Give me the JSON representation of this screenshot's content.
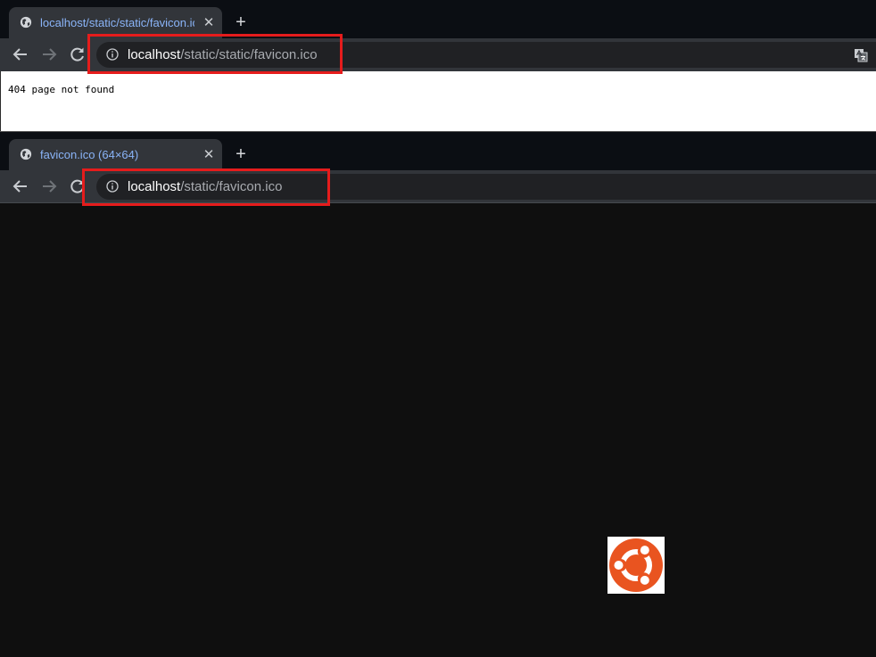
{
  "windows": [
    {
      "tab": {
        "title": "localhost/static/static/favicon.ico",
        "close_glyph": "✕",
        "favicon_icon": "globe-icon"
      },
      "new_tab_glyph": "+",
      "address": {
        "host": "localhost",
        "path": "/static/static/favicon.ico"
      },
      "content": {
        "text": "404 page not found"
      }
    },
    {
      "tab": {
        "title": "favicon.ico (64×64)",
        "close_glyph": "✕",
        "favicon_icon": "globe-icon"
      },
      "new_tab_glyph": "+",
      "address": {
        "host": "localhost",
        "path": "/static/favicon.ico"
      },
      "content": {
        "image_icon": "ubuntu-logo-icon"
      }
    }
  ],
  "colors": {
    "highlight": "#e51c1c",
    "tab_text": "#8ab4f8",
    "ubuntu_orange": "#e95420"
  }
}
